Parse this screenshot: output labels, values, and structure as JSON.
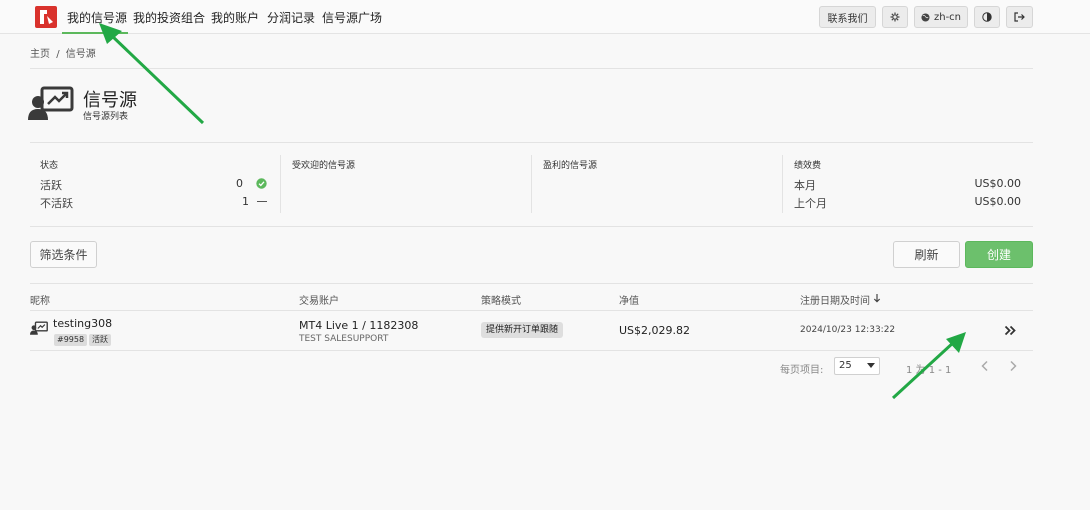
{
  "nav": {
    "items": [
      "我的信号源",
      "我的投资组合",
      "我的账户",
      "分润记录",
      "信号源广场"
    ],
    "contact_label": "联系我们",
    "lang_label": "zh-cn"
  },
  "breadcrumb": {
    "home": "主页",
    "sep": "/",
    "current": "信号源"
  },
  "header": {
    "title": "信号源",
    "subtitle": "信号源列表"
  },
  "stats": {
    "status": {
      "title": "状态",
      "active_label": "活跃",
      "active_count": "0",
      "inactive_label": "不活跃",
      "inactive_count": "1"
    },
    "popular": {
      "title": "受欢迎的信号源"
    },
    "profitable": {
      "title": "盈利的信号源"
    },
    "fees": {
      "title": "绩效费",
      "this_month_label": "本月",
      "this_month_value": "US$0.00",
      "last_month_label": "上个月",
      "last_month_value": "US$0.00"
    }
  },
  "toolbar": {
    "filter_label": "筛选条件",
    "refresh_label": "刷新",
    "create_label": "创建"
  },
  "table": {
    "headers": {
      "nickname": "昵称",
      "account": "交易账户",
      "mode": "策略模式",
      "equity": "净值",
      "registered": "注册日期及时间"
    },
    "rows": [
      {
        "nickname": "testing308",
        "id_tag": "#9958",
        "status_tag": "活跃",
        "account": "MT4 Live 1 / 1182308",
        "account_sub": "TEST SALESUPPORT",
        "mode": "提供新开订单跟随",
        "equity": "US$2,029.82",
        "registered": "2024/10/23 12:33:22"
      }
    ]
  },
  "pagination": {
    "per_page_label": "每页项目:",
    "per_page_value": "25",
    "range": "1 为 1 - 1"
  },
  "colors": {
    "accent": "#5cb85c",
    "logo": "#d9322c",
    "annotation_arrow": "#22a845"
  }
}
